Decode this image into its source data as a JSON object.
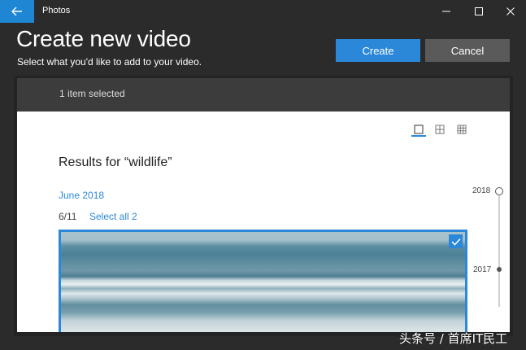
{
  "window": {
    "app_title": "Photos",
    "back_icon": "back-arrow-icon",
    "controls": [
      "minimize-icon",
      "maximize-icon",
      "close-icon"
    ]
  },
  "header": {
    "title": "Create new video",
    "subtitle": "Select what you'd like to add to your video.",
    "create_label": "Create",
    "cancel_label": "Cancel"
  },
  "selection": {
    "status_text": "1 item selected"
  },
  "view_modes": [
    "single-view-icon",
    "medium-grid-icon",
    "small-grid-icon"
  ],
  "results": {
    "title": "Results for “wildlife”",
    "month": "June 2018",
    "date": "6/11",
    "select_all": "Select all 2",
    "thumbnail_selected": true
  },
  "timeline": {
    "years": [
      "2018",
      "2017"
    ]
  },
  "watermark": "头条号 / 首席IT民工",
  "colors": {
    "accent": "#2b88d8",
    "background": "#2b2b2b",
    "cancel_button": "#5a5a5a"
  }
}
